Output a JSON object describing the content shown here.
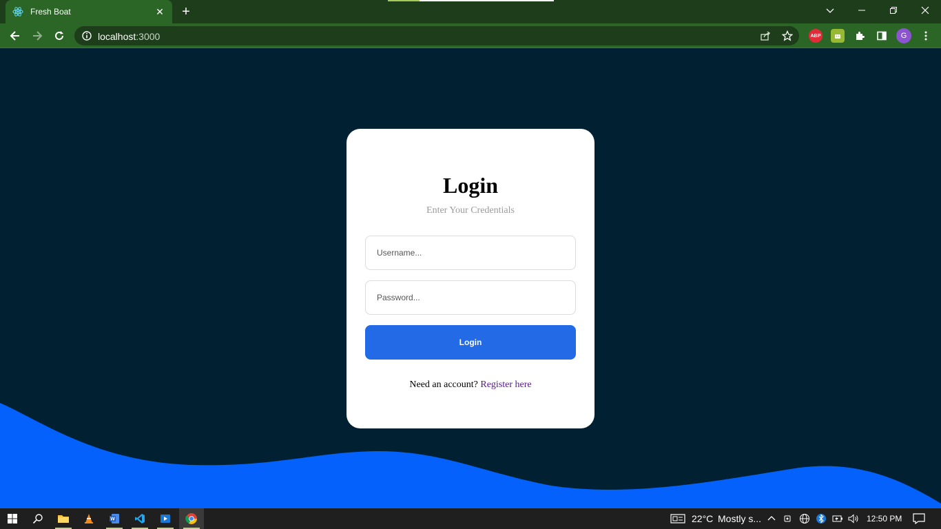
{
  "browser": {
    "tab": {
      "title": "Fresh Boat",
      "favicon": "react-logo-icon"
    },
    "url": {
      "host": "localhost",
      "port": ":3000"
    },
    "profile_initial": "G",
    "extensions": [
      "adblock-plus-icon",
      "android-extension-icon",
      "puzzle-icon",
      "side-panel-icon"
    ],
    "abp_label": "ABP"
  },
  "login": {
    "title": "Login",
    "subtitle": "Enter Your Credentials",
    "username_placeholder": "Username...",
    "password_placeholder": "Password...",
    "button_label": "Login",
    "register_prompt": "Need an account? ",
    "register_link": "Register here"
  },
  "taskbar": {
    "apps": [
      "file-explorer-icon",
      "vlc-icon",
      "word-icon",
      "vscode-icon",
      "photos-icon",
      "chrome-icon"
    ],
    "weather": {
      "temp": "22°C",
      "condition": "Mostly s..."
    },
    "time": "12:50 PM"
  },
  "colors": {
    "page_bg": "#012032",
    "wave": "#0461fb",
    "button": "#226ae6",
    "chrome": "#2b6627"
  }
}
